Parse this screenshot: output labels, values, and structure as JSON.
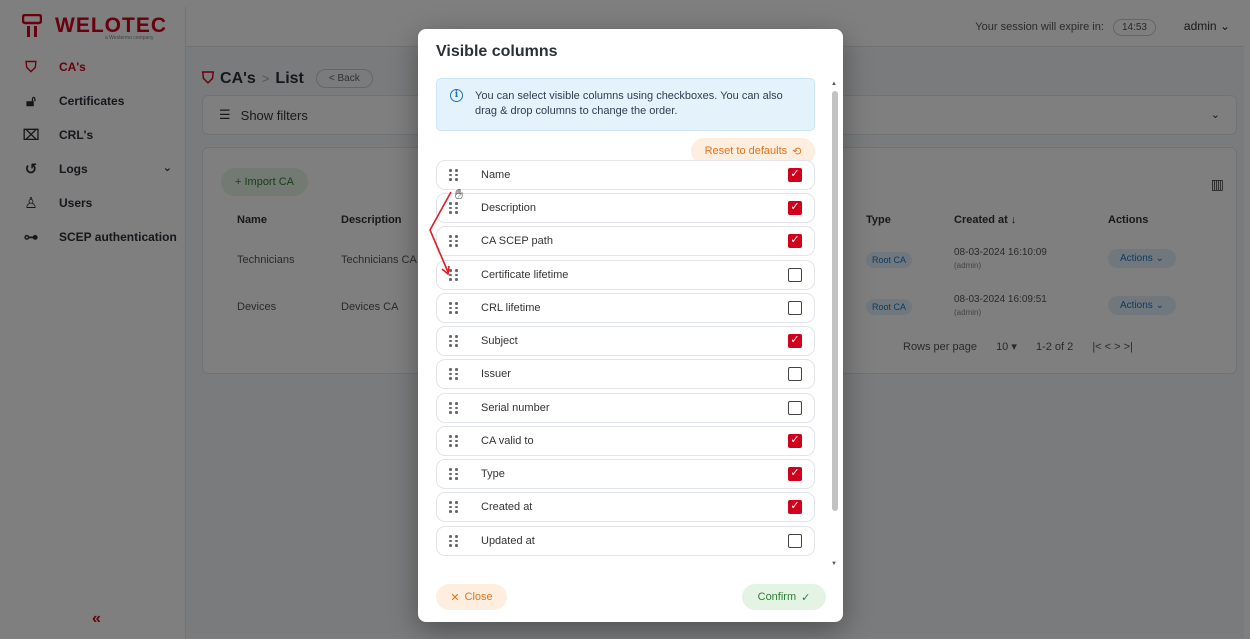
{
  "app": {
    "logo_text": "WELOTEC",
    "logo_sub": "a Westermo company",
    "session_label": "Your session will expire in:",
    "session_timer": "14:53",
    "user": "admin"
  },
  "sidebar": {
    "items": [
      {
        "label": "CA's",
        "icon": "shield-check-icon"
      },
      {
        "label": "Certificates",
        "icon": "lock-icon"
      },
      {
        "label": "CRL's",
        "icon": "x-box-icon"
      },
      {
        "label": "Logs",
        "icon": "history-icon"
      },
      {
        "label": "Users",
        "icon": "user-icon"
      },
      {
        "label": "SCEP authentication",
        "icon": "key-icon"
      }
    ],
    "collapse": "«"
  },
  "page": {
    "breadcrumb_root": "CA's",
    "breadcrumb_sep": ">",
    "breadcrumb_current": "List",
    "back_label": "< Back",
    "filters_label": "Show filters",
    "import_label": "+ Import CA",
    "headers": {
      "name": "Name",
      "description": "Description",
      "type": "Type",
      "created_at": "Created at ↓",
      "actions": "Actions"
    },
    "rows": [
      {
        "name": "Technicians",
        "description": "Technicians CA",
        "type": "Root CA",
        "created": "08-03-2024 16:10:09",
        "by": "(admin)",
        "actions": "Actions ⌄"
      },
      {
        "name": "Devices",
        "description": "Devices CA",
        "type": "Root CA",
        "created": "08-03-2024 16:09:51",
        "by": "(admin)",
        "actions": "Actions ⌄"
      }
    ],
    "rows_per_page_label": "Rows per page",
    "rows_per_page": "10 ▾",
    "range": "1-2 of 2",
    "pager_icons": "|<   <   >   >|"
  },
  "modal": {
    "title": "Visible columns",
    "info": "You can select visible columns using checkboxes. You can also drag & drop columns to change the order.",
    "reset_label": "Reset to defaults",
    "columns": [
      {
        "label": "Name",
        "checked": true
      },
      {
        "label": "Description",
        "checked": true
      },
      {
        "label": "CA SCEP path",
        "checked": true
      },
      {
        "label": "Certificate lifetime",
        "checked": false
      },
      {
        "label": "CRL lifetime",
        "checked": false
      },
      {
        "label": "Subject",
        "checked": true
      },
      {
        "label": "Issuer",
        "checked": false
      },
      {
        "label": "Serial number",
        "checked": false
      },
      {
        "label": "CA valid to",
        "checked": true
      },
      {
        "label": "Type",
        "checked": true
      },
      {
        "label": "Created at",
        "checked": true
      },
      {
        "label": "Updated at",
        "checked": false
      }
    ],
    "close_label": "Close",
    "confirm_label": "Confirm"
  },
  "colors": {
    "brand": "#d0021b",
    "info_bg": "#e3f2fb",
    "orange": "#e8731b",
    "green": "#2e7d32"
  }
}
